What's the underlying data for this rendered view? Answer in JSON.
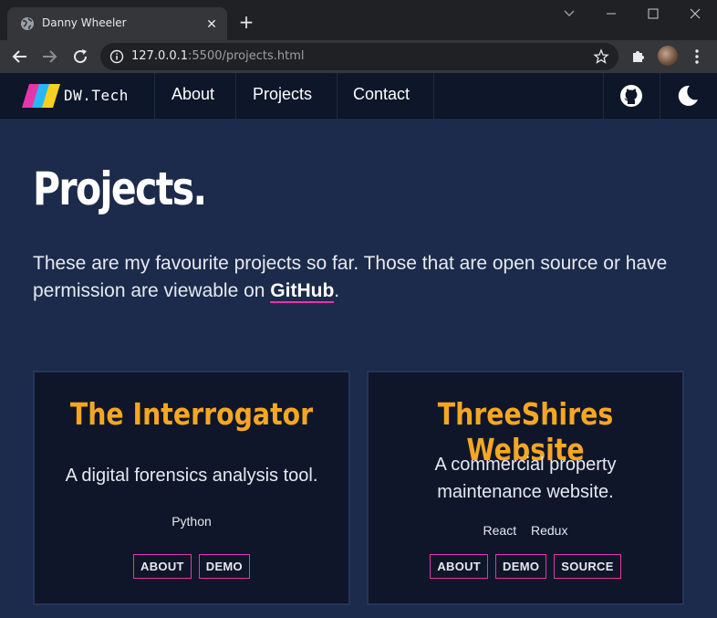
{
  "browser": {
    "tab_title": "Danny Wheeler",
    "url_host": "127.0.0.1",
    "url_rest": ":5500/projects.html"
  },
  "nav": {
    "logo_text": "DW.Tech",
    "links": [
      "About",
      "Projects",
      "Contact"
    ]
  },
  "page": {
    "title": "Projects.",
    "intro_text": "These are my favourite projects so far. Those that are open source or have permission are viewable on ",
    "intro_link": "GitHub",
    "intro_end": "."
  },
  "projects": [
    {
      "title": "The Interrogator",
      "description": "A digital forensics analysis tool.",
      "tags": [
        "Python"
      ],
      "buttons": [
        "ABOUT",
        "DEMO"
      ]
    },
    {
      "title": "ThreeShires Website",
      "description": "A commercial property maintenance website.",
      "tags": [
        "React",
        "Redux"
      ],
      "buttons": [
        "ABOUT",
        "DEMO",
        "SOURCE"
      ]
    }
  ],
  "colors": {
    "accent_title": "#f5a623",
    "accent_border": "#e535ab",
    "page_bg": "#1c2b4b",
    "nav_bg": "#0e1629"
  }
}
